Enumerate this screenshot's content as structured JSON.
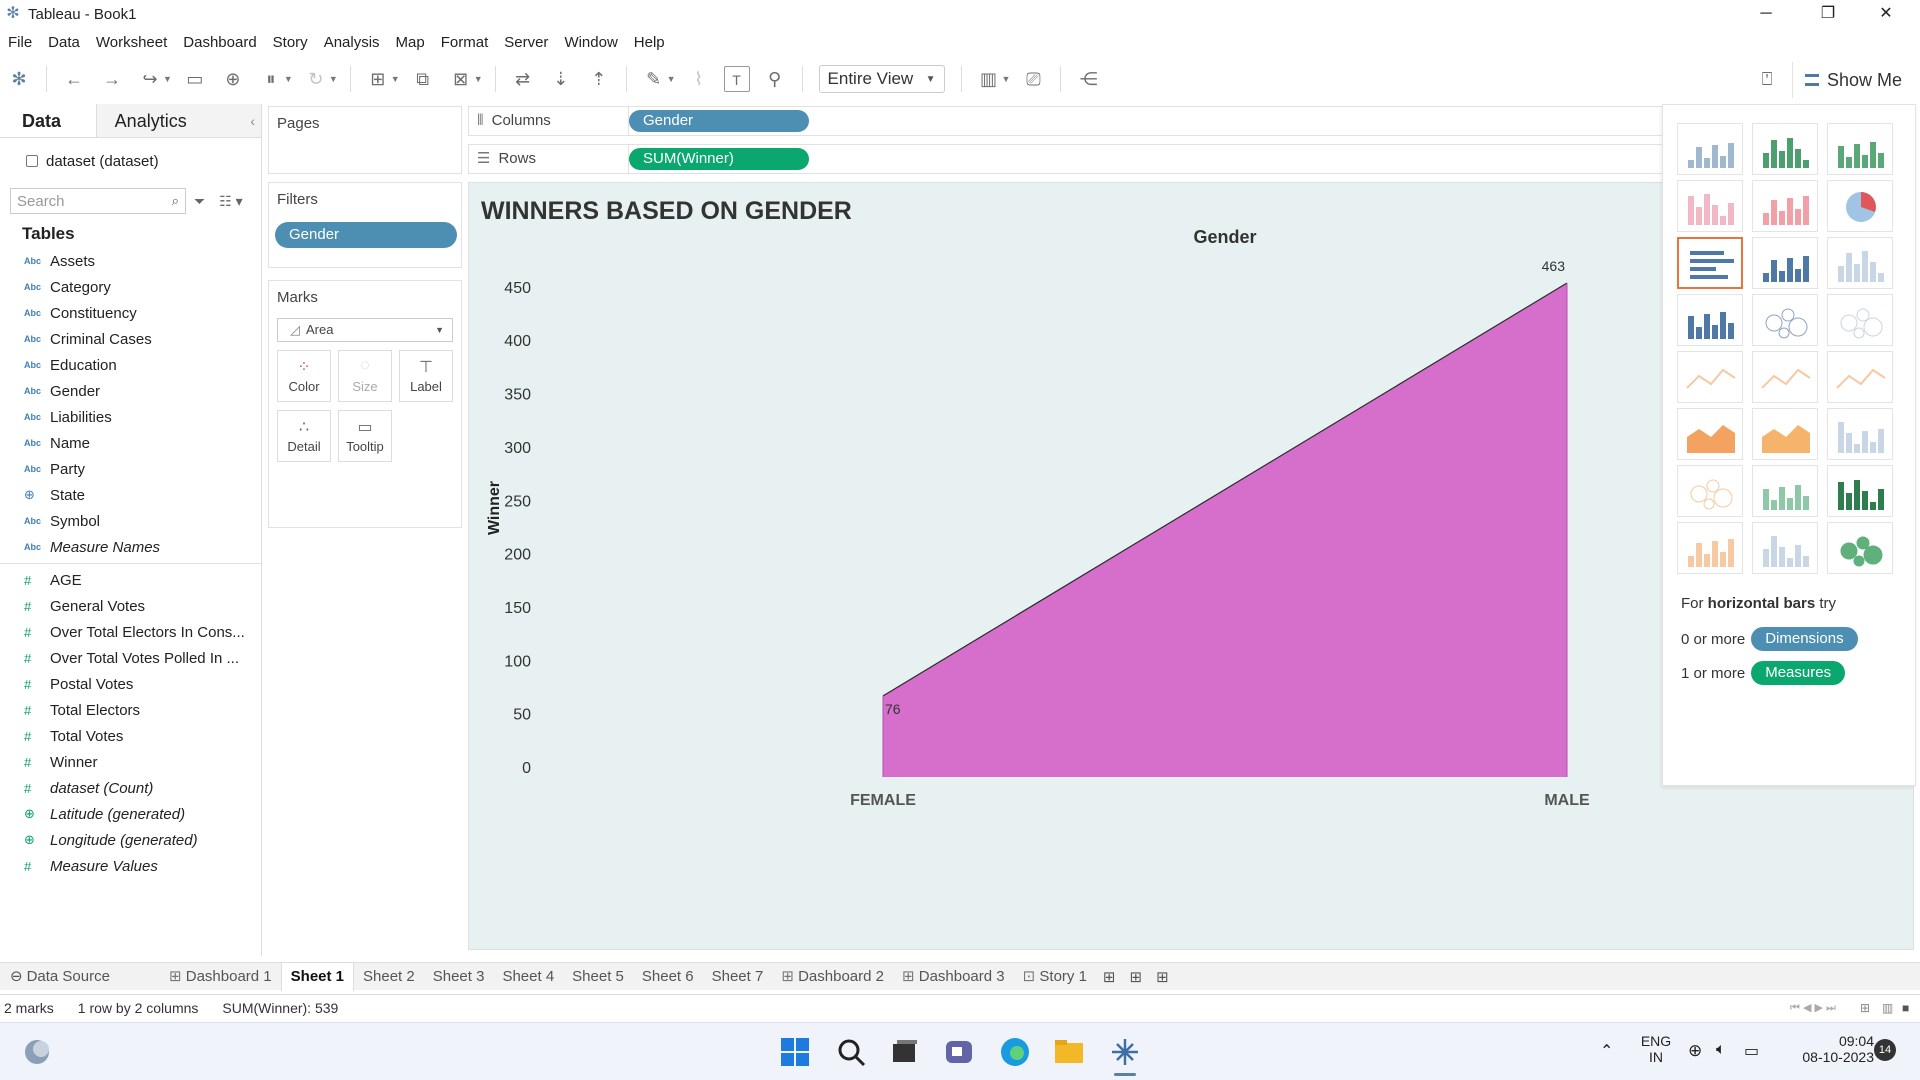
{
  "window": {
    "title": "Tableau - Book1"
  },
  "menu": [
    "File",
    "Data",
    "Worksheet",
    "Dashboard",
    "Story",
    "Analysis",
    "Map",
    "Format",
    "Server",
    "Window",
    "Help"
  ],
  "toolbar": {
    "fit_option": "Entire View",
    "show_me_label": "Show Me"
  },
  "data_pane": {
    "tab_data": "Data",
    "tab_analytics": "Analytics",
    "datasource": "dataset (dataset)",
    "search_placeholder": "Search",
    "tables_heading": "Tables",
    "dimensions": [
      {
        "type": "Abc",
        "label": "Assets",
        "italic": false
      },
      {
        "type": "Abc",
        "label": "Category",
        "italic": false
      },
      {
        "type": "Abc",
        "label": "Constituency",
        "italic": false
      },
      {
        "type": "Abc",
        "label": "Criminal Cases",
        "italic": false
      },
      {
        "type": "Abc",
        "label": "Education",
        "italic": false
      },
      {
        "type": "Abc",
        "label": "Gender",
        "italic": false
      },
      {
        "type": "Abc",
        "label": "Liabilities",
        "italic": false
      },
      {
        "type": "Abc",
        "label": "Name",
        "italic": false
      },
      {
        "type": "Abc",
        "label": "Party",
        "italic": false
      },
      {
        "type": "geo",
        "label": "State",
        "italic": false
      },
      {
        "type": "Abc",
        "label": "Symbol",
        "italic": false
      },
      {
        "type": "Abc",
        "label": "Measure Names",
        "italic": true
      }
    ],
    "measures": [
      {
        "type": "#",
        "label": "AGE",
        "italic": false
      },
      {
        "type": "#",
        "label": "General Votes",
        "italic": false
      },
      {
        "type": "#",
        "label": "Over Total Electors  In Cons...",
        "italic": false
      },
      {
        "type": "#",
        "label": "Over Total Votes Polled  In ...",
        "italic": false
      },
      {
        "type": "#",
        "label": "Postal Votes",
        "italic": false
      },
      {
        "type": "#",
        "label": "Total Electors",
        "italic": false
      },
      {
        "type": "#",
        "label": "Total Votes",
        "italic": false
      },
      {
        "type": "#",
        "label": "Winner",
        "italic": false
      },
      {
        "type": "#",
        "label": "dataset (Count)",
        "italic": true
      },
      {
        "type": "geo",
        "label": "Latitude (generated)",
        "italic": true
      },
      {
        "type": "geo",
        "label": "Longitude (generated)",
        "italic": true
      },
      {
        "type": "#",
        "label": "Measure Values",
        "italic": true
      }
    ]
  },
  "cards": {
    "pages": "Pages",
    "filters": "Filters",
    "filter_pill": "Gender",
    "marks": "Marks",
    "mark_type": "Area",
    "mark_buttons": [
      {
        "label": "Color",
        "icon": "color-dots-icon",
        "dim": false
      },
      {
        "label": "Size",
        "icon": "size-icon",
        "dim": true
      },
      {
        "label": "Label",
        "icon": "label-t-icon",
        "dim": false
      },
      {
        "label": "Detail",
        "icon": "detail-dots-icon",
        "dim": false
      },
      {
        "label": "Tooltip",
        "icon": "tooltip-bubble-icon",
        "dim": false
      }
    ]
  },
  "shelves": {
    "columns_label": "Columns",
    "columns_pill": "Gender",
    "rows_label": "Rows",
    "rows_pill": "SUM(Winner)",
    "dimension_color": "#4d8fb2",
    "measure_color": "#0aa86f"
  },
  "sheet_title": "WINNERS BASED ON GENDER",
  "chart_data": {
    "type": "area",
    "title": "Gender",
    "xlabel": "",
    "ylabel": "Winner",
    "categories": [
      "FEMALE",
      "MALE"
    ],
    "series": [
      {
        "values": [
          76,
          463
        ]
      }
    ],
    "data_labels": [
      "76",
      "463"
    ],
    "y_ticks": [
      0,
      50,
      100,
      150,
      200,
      250,
      300,
      350,
      400,
      450
    ],
    "ylim": [
      0,
      463
    ],
    "fill_color": "#d56fcb",
    "background_color": "#e8f1f1",
    "grid": false
  },
  "show_me": {
    "hint_prefix": "For ",
    "hint_bold": "horizontal bars",
    "hint_suffix": " try",
    "dim_prefix": "0 or more",
    "dim_pill": "Dimensions",
    "meas_prefix": "1 or more",
    "meas_pill": "Measures"
  },
  "sheet_tabs": {
    "data_source": "Data Source",
    "tabs": [
      {
        "label": "Dashboard 1",
        "icon": "dashboard-icon"
      },
      {
        "label": "Sheet 1",
        "icon": ""
      },
      {
        "label": "Sheet 2",
        "icon": ""
      },
      {
        "label": "Sheet 3",
        "icon": ""
      },
      {
        "label": "Sheet 4",
        "icon": ""
      },
      {
        "label": "Sheet 5",
        "icon": ""
      },
      {
        "label": "Sheet 6",
        "icon": ""
      },
      {
        "label": "Sheet 7",
        "icon": ""
      },
      {
        "label": "Dashboard 2",
        "icon": "dashboard-icon"
      },
      {
        "label": "Dashboard 3",
        "icon": "dashboard-icon"
      },
      {
        "label": "Story 1",
        "icon": "story-icon"
      }
    ],
    "active": "Sheet 1"
  },
  "status": {
    "marks": "2 marks",
    "dims": "1 row by 2 columns",
    "sum": "SUM(Winner): 539"
  },
  "taskbar": {
    "lang": "ENG",
    "region": "IN",
    "time": "09:04",
    "date": "08-10-2023",
    "notifications": "14"
  }
}
